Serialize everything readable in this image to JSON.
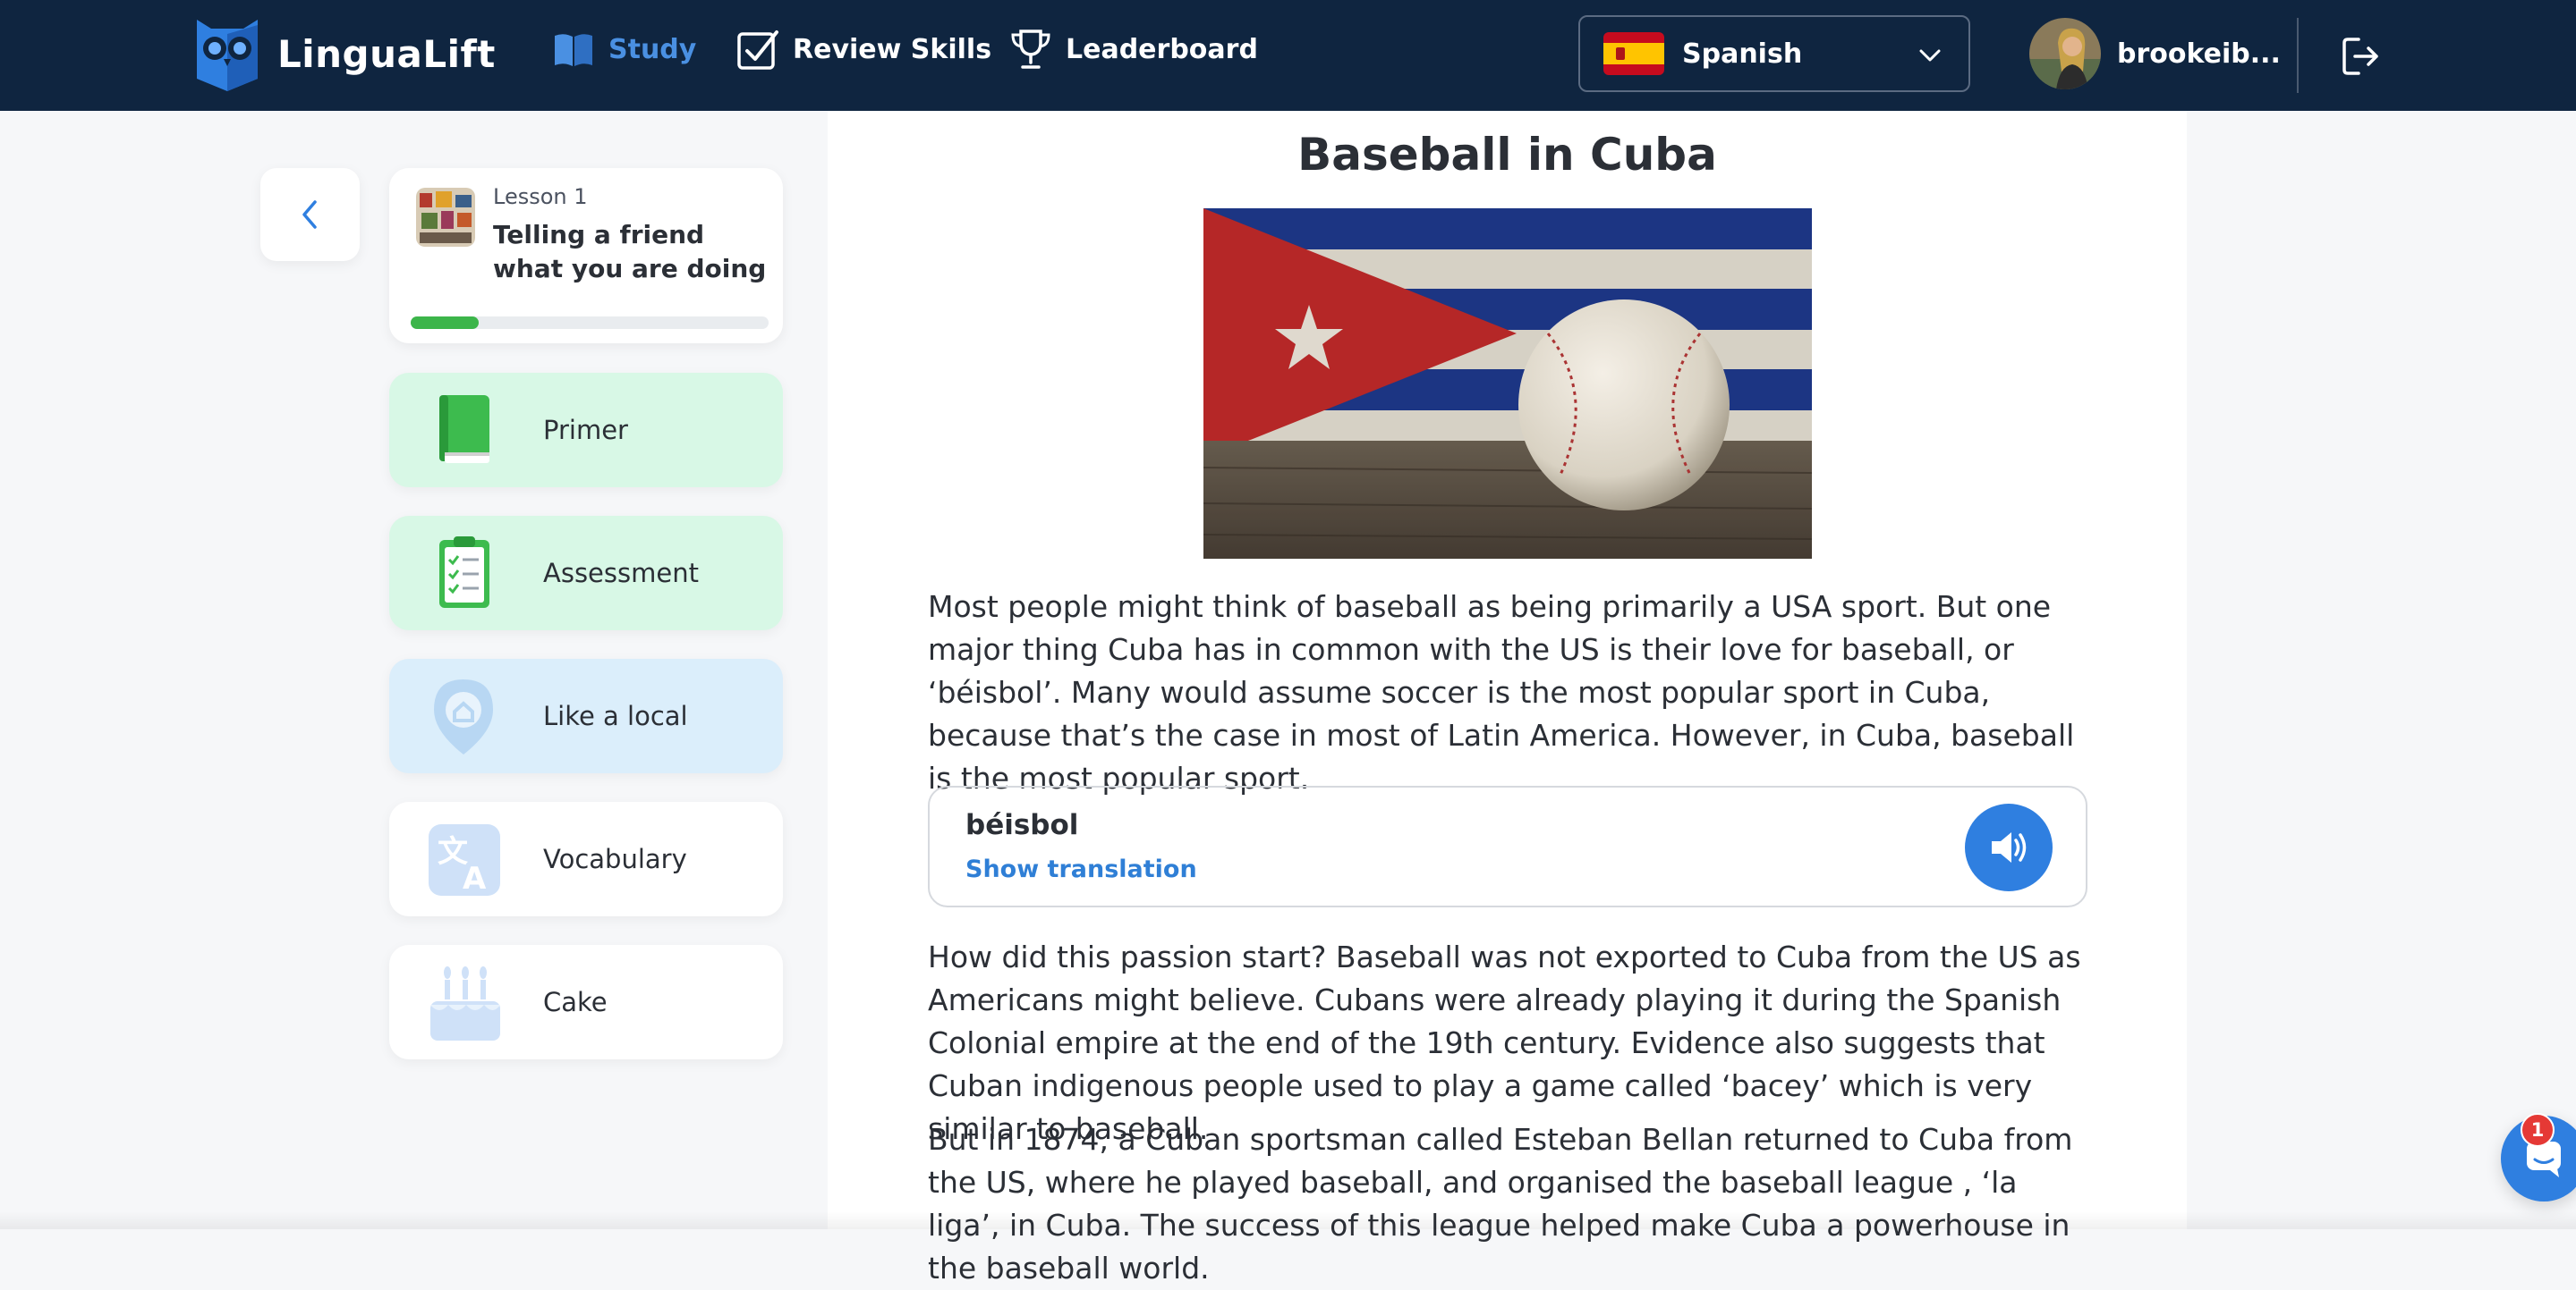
{
  "app": {
    "name": "LinguaLift"
  },
  "nav": {
    "study": "Study",
    "review": "Review Skills",
    "leaderboard": "Leaderboard"
  },
  "language": {
    "selected": "Spanish"
  },
  "user": {
    "name": "brookeib..."
  },
  "lesson": {
    "number_label": "Lesson 1",
    "title": "Telling a friend what you are doing",
    "progress": 0.19
  },
  "sidebar": {
    "items": [
      {
        "label": "Primer",
        "icon": "green-book-icon",
        "state": "completed"
      },
      {
        "label": "Assessment",
        "icon": "clipboard-checklist-icon",
        "state": "completed"
      },
      {
        "label": "Like a local",
        "icon": "location-pin-icon",
        "state": "active"
      },
      {
        "label": "Vocabulary",
        "icon": "translate-icon",
        "state": "default"
      },
      {
        "label": "Cake",
        "icon": "birthday-cake-icon",
        "state": "default"
      }
    ]
  },
  "article": {
    "title": "Baseball in Cuba",
    "paragraph1": "Most people might think of baseball as being primarily a USA sport. But one major thing Cuba has in common with the US is their love for baseball, or ‘béisbol’. Many would assume soccer is the most popular sport in Cuba, because that’s the case in most of Latin America. However, in Cuba, baseball is the most popular sport.",
    "vocab": {
      "word": "béisbol",
      "show_translation": "Show translation"
    },
    "paragraph2": "How did this passion start? Baseball was not exported to Cuba from the US as Americans might believe. Cubans were already playing it during the Spanish Colonial empire at the end of the 19th century. Evidence also suggests that Cuban indigenous people used to play a game called ‘bacey’ which is very similar to baseball.",
    "paragraph3": "But in 1874, a Cuban sportsman called Esteban Bellan returned to Cuba from the US, where he played baseball, and organised the baseball league , ‘la liga’, in Cuba. The success of this league helped make Cuba a powerhouse in the baseball world."
  },
  "chat": {
    "badge": "1"
  },
  "colors": {
    "topbar": "#0f2540",
    "accent": "#2f7fe0",
    "study_active": "#4a90e2",
    "progress": "#3cb54a",
    "completed_bg": "#d8f8e6",
    "active_bg": "#dbeefb"
  }
}
